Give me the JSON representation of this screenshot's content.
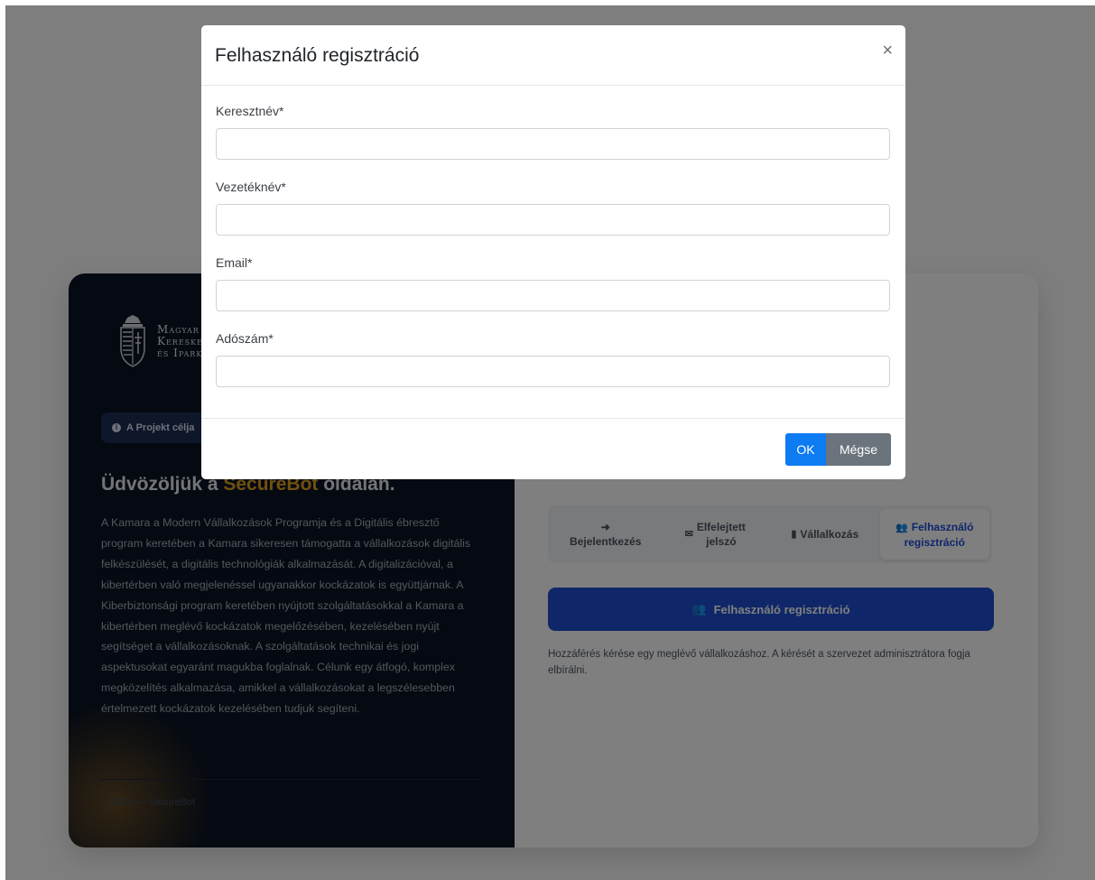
{
  "logo": {
    "lines": [
      "Magyar",
      "Kereskedelmi",
      "és Iparkamara"
    ]
  },
  "left": {
    "project_pill": "A Projekt célja",
    "welcome_prefix": "Üdvözöljük a ",
    "welcome_brand": "SecureBot",
    "welcome_suffix": " oldalán.",
    "description": "A Kamara a Modern Vállalkozások Programja és a Digitális ébresztő program keretében a Kamara sikeresen támogatta a vállalkozások digitális felkészülését, a digitális technológiák alkalmazását. A digitalizációval, a kibertérben való megjelenéssel ugyanakkor kockázatok is együttjárnak. A Kiberbiztonsági program keretében nyújtott szolgáltatásokkal a Kamara a kibertérben meglévő kockázatok megelőzésében, kezelésében nyújt segítséget a vállalkozásoknak. A szolgáltatások technikai és jogi aspektusokat egyaránt magukba foglalnak. Célunk egy átfogó, komplex megközelítés alkalmazása, amikkel a vállalkozásokat a legszélesebben értelmezett kockázatok kezelésében tudjuk segíteni.",
    "footer": "© 2026 — SecureBot"
  },
  "tabs": [
    {
      "icon": "login-icon",
      "glyph": "➜",
      "line1": "",
      "line2": "Bejelentkezés"
    },
    {
      "icon": "envelope-icon",
      "glyph": "✉",
      "line1": "Elfelejtett",
      "line2": "jelszó"
    },
    {
      "icon": "building-icon",
      "glyph": "▮",
      "line1": "",
      "line2": "Vállalkozás"
    },
    {
      "icon": "user-plus-icon",
      "glyph": "👥",
      "line1": "Felhasználó",
      "line2": "regisztráció"
    }
  ],
  "primary_button": {
    "label": "Felhasználó regisztráció"
  },
  "help_text": "Hozzáférés kérése egy meglévő vállalkozáshoz. A kérését a szervezet adminisztrátora fogja elbírálni.",
  "modal": {
    "title": "Felhasználó regisztráció",
    "close": "×",
    "fields": [
      {
        "label": "Keresztnév*",
        "value": ""
      },
      {
        "label": "Vezetéknév*",
        "value": ""
      },
      {
        "label": "Email*",
        "value": ""
      },
      {
        "label": "Adószám*",
        "value": ""
      }
    ],
    "ok_label": "OK",
    "cancel_label": "Mégse"
  },
  "colors": {
    "left_panel": "#0b1322",
    "brand": "#e1a020",
    "primary": "#1f4fd1",
    "ok": "#0d7bf2",
    "cancel": "#6b747c"
  }
}
